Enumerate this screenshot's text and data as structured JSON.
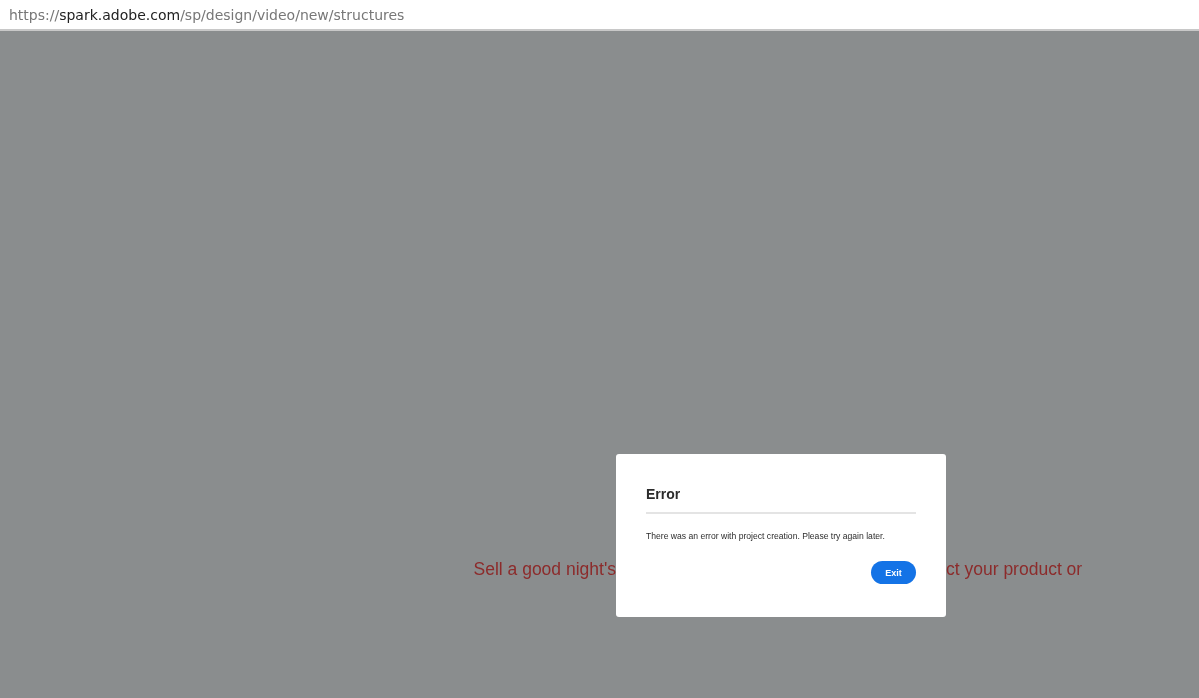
{
  "address_bar": {
    "scheme": "https://",
    "host": "spark.adobe.com",
    "path": "/sp/design/video/new/structures"
  },
  "background_text": {
    "left": "Sell a good night's",
    "right": "ct your product or"
  },
  "dialog": {
    "title": "Error",
    "message": "There was an error with project creation. Please try again later.",
    "button": "Exit"
  }
}
